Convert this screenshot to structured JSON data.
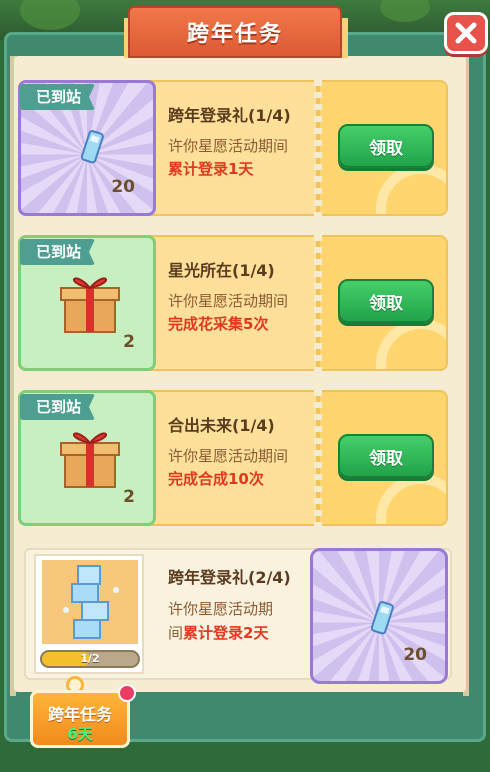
{
  "title": "跨年任务",
  "colors": {
    "accent": "#dd5a34",
    "claim": "#21a34a",
    "highlight": "#e0391f"
  },
  "tasks": [
    {
      "badge": "已到站",
      "reward_icon": "ticket-icon",
      "reward_count": "20",
      "title": "跨年登录礼(1/4)",
      "desc": "许你星愿活动期间",
      "requirement": "累计登录1天",
      "button": "领取"
    },
    {
      "badge": "已到站",
      "reward_icon": "gift-box-icon",
      "reward_count": "2",
      "title": "星光所在(1/4)",
      "desc": "许你星愿活动期间",
      "requirement": "完成花采集5次",
      "button": "领取"
    },
    {
      "badge": "已到站",
      "reward_icon": "gift-box-icon",
      "reward_count": "2",
      "title": "合出未来(1/4)",
      "desc": "许你星愿活动期间",
      "requirement": "完成合成10次",
      "button": "领取"
    }
  ],
  "next_task": {
    "title": "跨年登录礼(2/4)",
    "desc_line1": "许你星愿活动期",
    "desc_line2_prefix": "间",
    "requirement": "累计登录2天",
    "progress_text": "1/2",
    "progress_value": 0.5,
    "reward_icon": "ticket-icon",
    "reward_count": "20"
  },
  "event_badge": {
    "title": "跨年任务",
    "days": "6天"
  }
}
